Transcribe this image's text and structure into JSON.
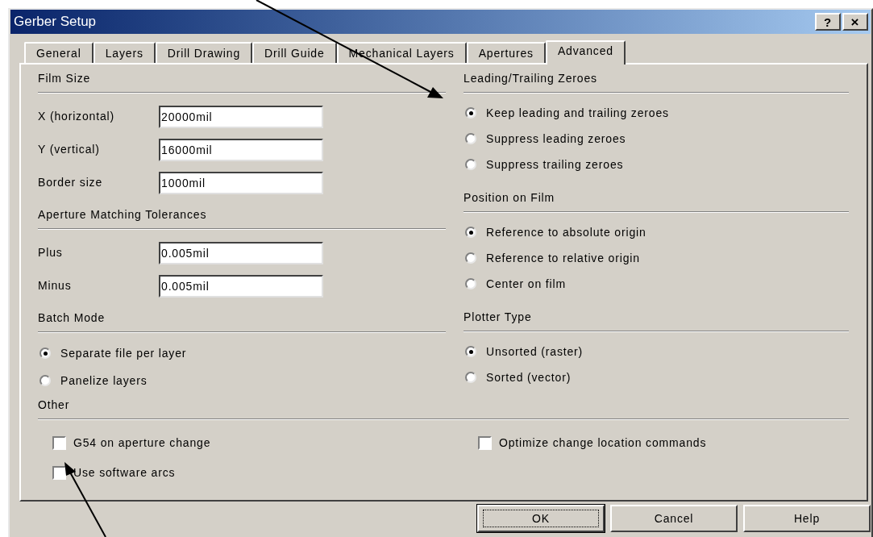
{
  "window": {
    "title": "Gerber Setup",
    "help_button": "?",
    "close_button": "×"
  },
  "tabs": [
    {
      "label": "General",
      "selected": false
    },
    {
      "label": "Layers",
      "selected": false
    },
    {
      "label": "Drill Drawing",
      "selected": false
    },
    {
      "label": "Drill Guide",
      "selected": false
    },
    {
      "label": "Mechanical Layers",
      "selected": false
    },
    {
      "label": "Apertures",
      "selected": false
    },
    {
      "label": "Advanced",
      "selected": true
    }
  ],
  "left": [
    {
      "kind": "fields",
      "title": "Film Size",
      "items": [
        {
          "label": "X (horizontal)",
          "value": "20000mil"
        },
        {
          "label": "Y (vertical)",
          "value": "16000mil"
        },
        {
          "label": "Border size",
          "value": "1000mil"
        }
      ]
    },
    {
      "kind": "fields",
      "title": "Aperture Matching Tolerances",
      "items": [
        {
          "label": "Plus",
          "value": "0.005mil"
        },
        {
          "label": "Minus",
          "value": "0.005mil"
        }
      ]
    },
    {
      "kind": "radios",
      "title": "Batch Mode",
      "items": [
        {
          "label": "Separate file per layer",
          "selected": true
        },
        {
          "label": "Panelize layers",
          "selected": false
        }
      ]
    }
  ],
  "right": [
    {
      "kind": "radios",
      "title": "Leading/Trailing Zeroes",
      "items": [
        {
          "label": "Keep leading and trailing zeroes",
          "selected": true
        },
        {
          "label": "Suppress leading zeroes",
          "selected": false
        },
        {
          "label": "Suppress trailing zeroes",
          "selected": false
        }
      ]
    },
    {
      "kind": "radios",
      "title": "Position on Film",
      "items": [
        {
          "label": "Reference to absolute origin",
          "selected": true
        },
        {
          "label": "Reference to relative origin",
          "selected": false
        },
        {
          "label": "Center on film",
          "selected": false
        }
      ]
    },
    {
      "kind": "radios",
      "title": "Plotter Type",
      "items": [
        {
          "label": "Unsorted (raster)",
          "selected": true
        },
        {
          "label": "Sorted (vector)",
          "selected": false
        }
      ]
    }
  ],
  "other": {
    "title": "Other",
    "options": [
      {
        "label": "G54 on aperture change",
        "checked": false
      },
      {
        "label": "Optimize change location commands",
        "checked": false
      },
      {
        "label": "Use software arcs",
        "checked": false
      }
    ]
  },
  "buttons": [
    {
      "label": "OK",
      "default": true
    },
    {
      "label": "Cancel",
      "default": false
    },
    {
      "label": "Help",
      "default": false
    }
  ]
}
